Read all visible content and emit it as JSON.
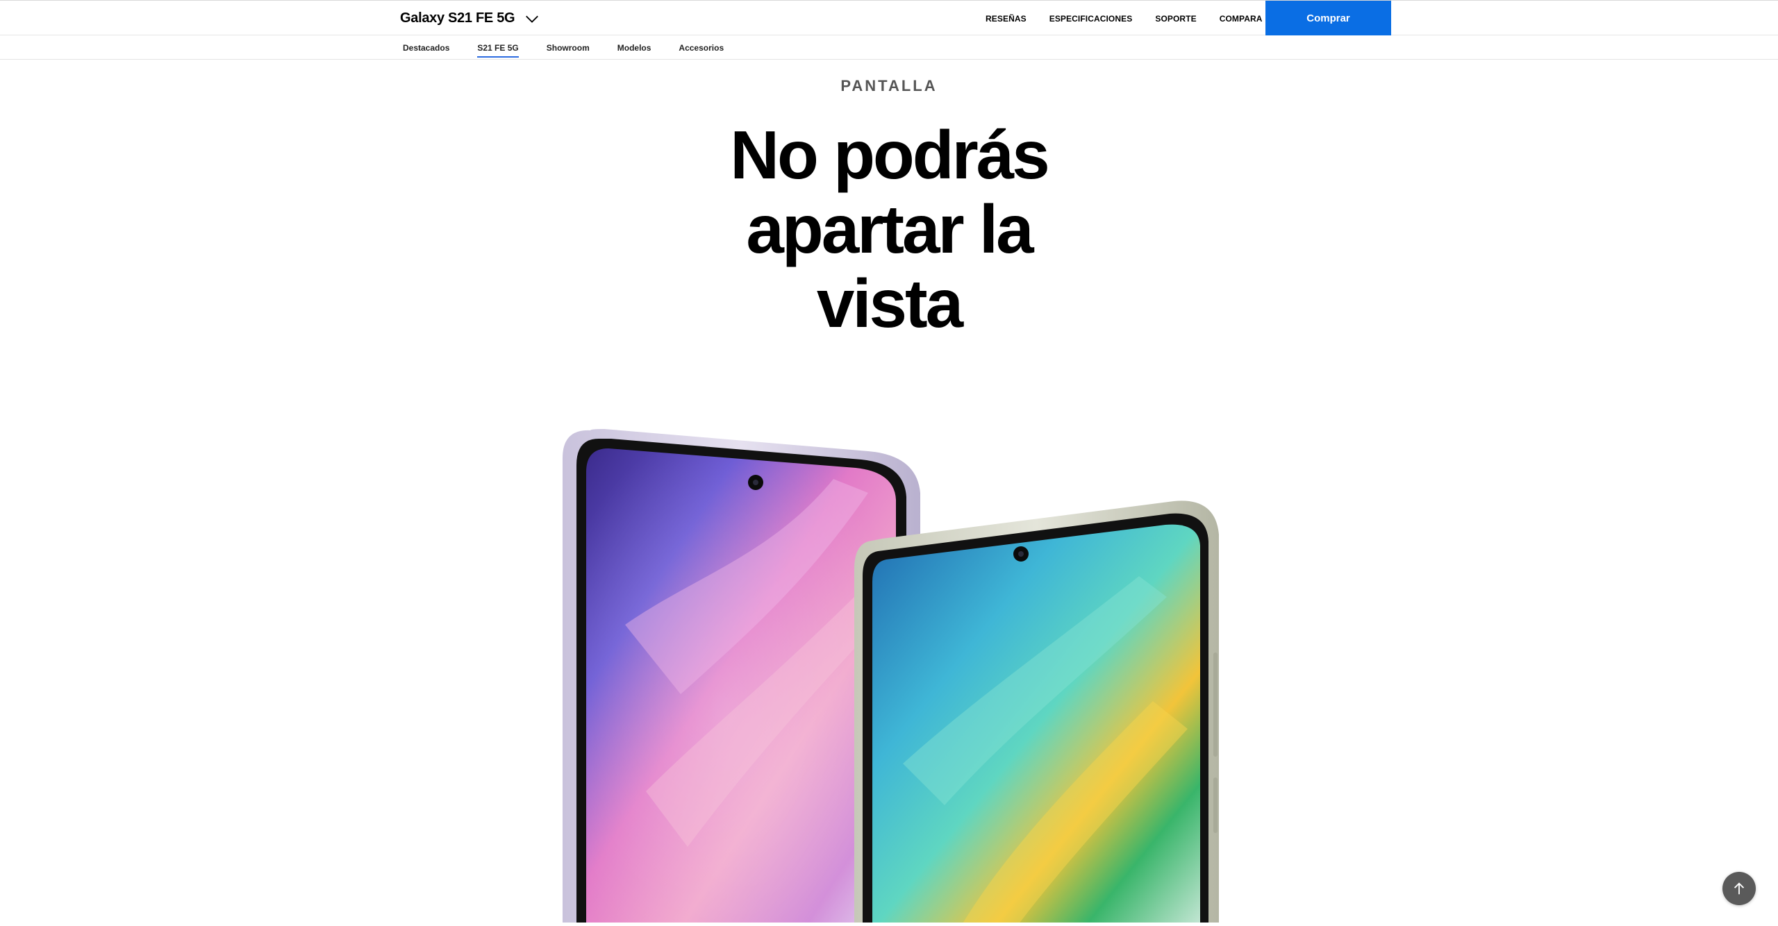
{
  "header": {
    "model_title": "Galaxy S21 FE 5G",
    "nav": [
      "RESEÑAS",
      "ESPECIFICACIONES",
      "SOPORTE",
      "COMPARA"
    ],
    "buy_label": "Comprar",
    "buy_color": "#0a6ee4"
  },
  "subnav": {
    "items": [
      "Destacados",
      "S21 FE 5G",
      "Showroom",
      "Modelos",
      "Accesorios"
    ],
    "active": "S21 FE 5G"
  },
  "section": {
    "eyebrow": "PANTALLA",
    "headline_line1": "No podrás",
    "headline_line2": "apartar la",
    "headline_line3": "vista"
  },
  "hero": {
    "phones": [
      "lavender",
      "olive"
    ]
  },
  "icons": {
    "model_dropdown": "chevron-down-icon",
    "back_to_top": "arrow-up-icon"
  }
}
